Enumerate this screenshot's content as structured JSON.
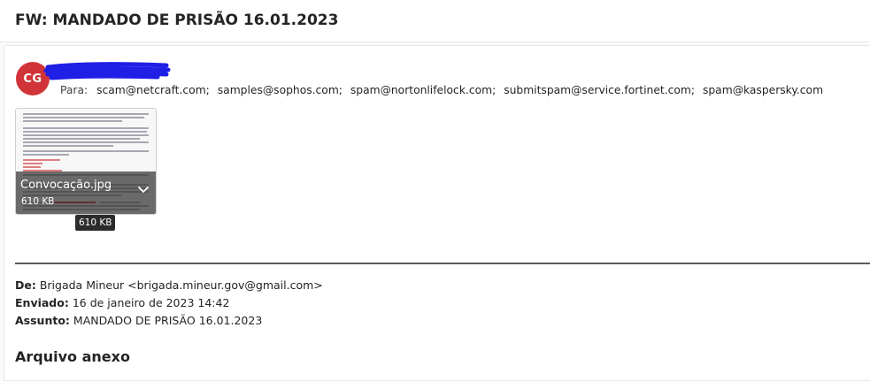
{
  "subject": "FW: MANDADO DE PRISÃO 16.01.2023",
  "sender": {
    "initials": "CG",
    "avatar_color": "#d13438"
  },
  "to": {
    "label": "Para:",
    "recipients": [
      "scam@netcraft.com;",
      "samples@sophos.com;",
      "spam@nortonlifelock.com;",
      "submitspam@service.fortinet.com;",
      "spam@kaspersky.com"
    ]
  },
  "attachment": {
    "name": "Convocação.jpg",
    "size": "610 KB",
    "tooltip": "610 KB"
  },
  "forwarded": {
    "from_label": "De:",
    "from_value": "Brigada Mineur <brigada.mineur.gov@gmail.com>",
    "sent_label": "Enviado:",
    "sent_value": "16 de janeiro de 2023 14:42",
    "subject_label": "Assunto:",
    "subject_value": "MANDADO DE PRISÃO 16.01.2023"
  },
  "section_heading": "Arquivo anexo",
  "colors": {
    "accent": "#d13438",
    "redaction": "#1f1fe6"
  },
  "icons": {
    "chevron": "chevron-down-icon"
  }
}
